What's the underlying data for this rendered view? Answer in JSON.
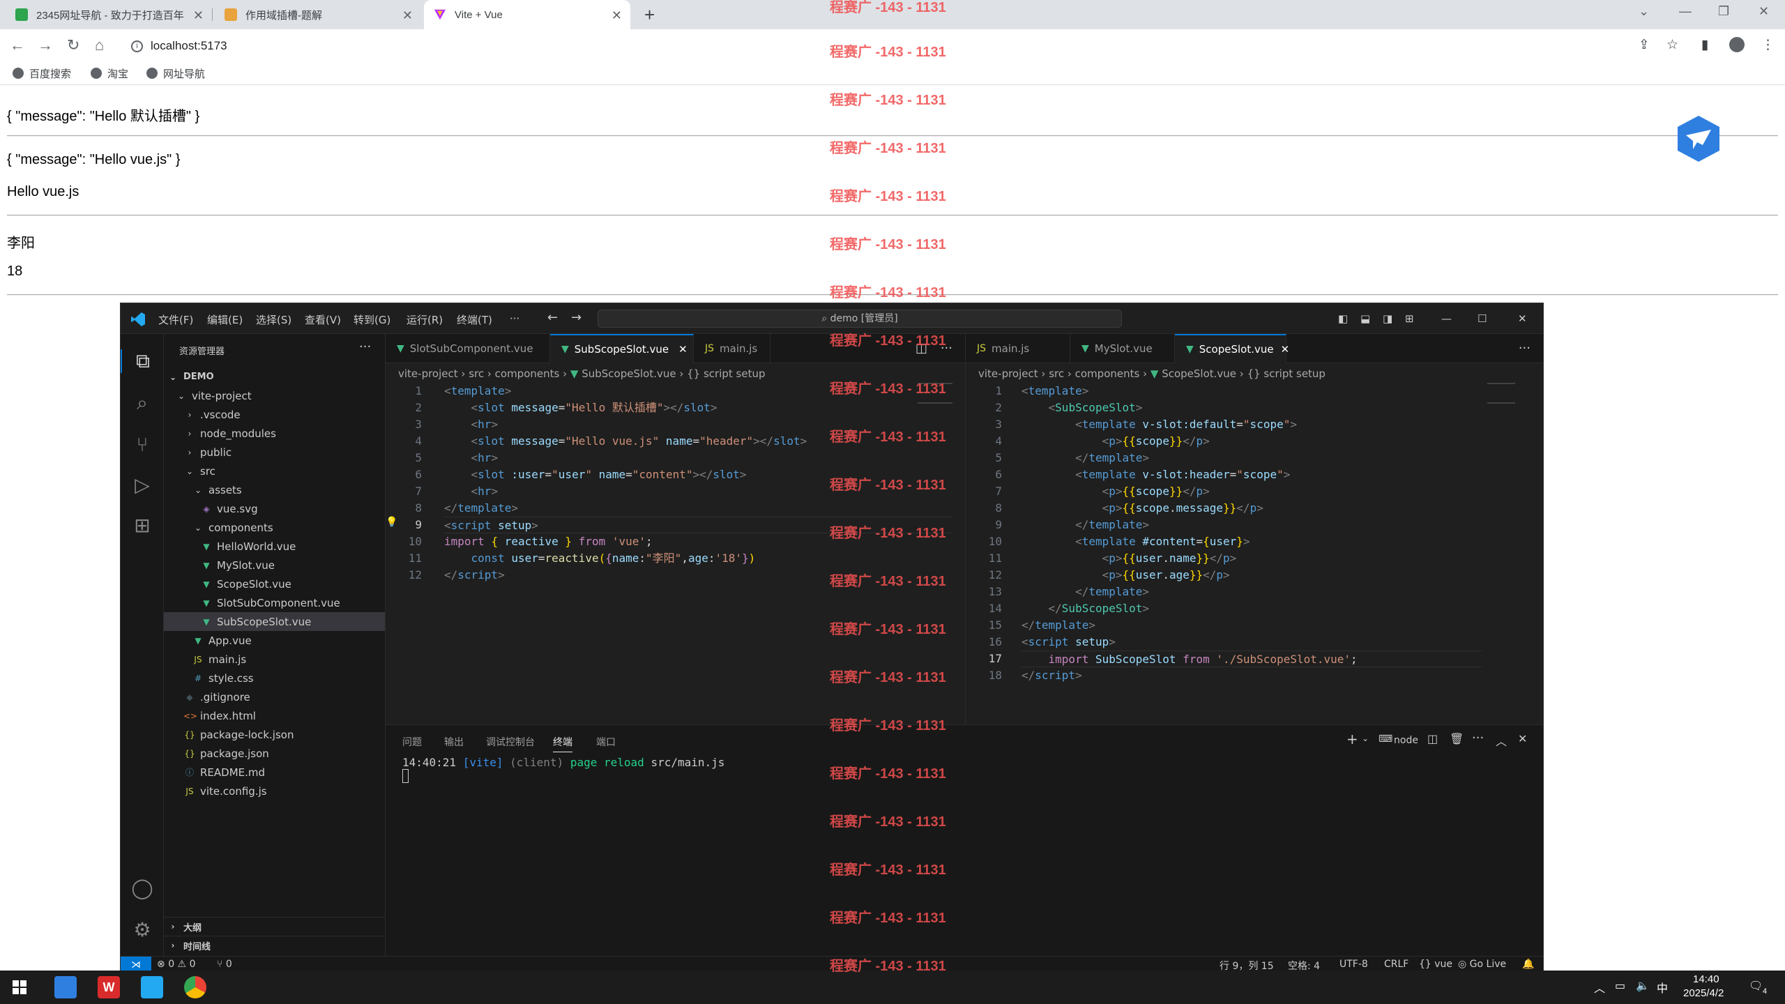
{
  "browser": {
    "tabs": [
      {
        "title": "2345网址导航 - 致力于打造百年"
      },
      {
        "title": "作用域插槽-题解"
      },
      {
        "title": "Vite + Vue"
      }
    ],
    "url": "localhost:5173",
    "bookmarks": [
      "百度搜索",
      "淘宝",
      "网址导航"
    ]
  },
  "page": {
    "lines": [
      "{ \"message\": \"Hello 默认插槽\" }",
      "{ \"message\": \"Hello vue.js\" }",
      "Hello vue.js",
      "李阳",
      "18"
    ],
    "watermark": "程赛广 -143 - 1131"
  },
  "vscode": {
    "menu": [
      "文件(F)",
      "编辑(E)",
      "选择(S)",
      "查看(V)",
      "转到(G)",
      "运行(R)",
      "终端(T)",
      "···"
    ],
    "command_center": "demo [管理员]",
    "explorer_title": "资源管理器",
    "tree": [
      {
        "label": "DEMO"
      },
      {
        "label": "vite-project"
      },
      {
        "label": ".vscode"
      },
      {
        "label": "node_modules"
      },
      {
        "label": "public"
      },
      {
        "label": "src"
      },
      {
        "label": "assets"
      },
      {
        "label": "vue.svg"
      },
      {
        "label": "components"
      },
      {
        "label": "HelloWorld.vue"
      },
      {
        "label": "MySlot.vue"
      },
      {
        "label": "ScopeSlot.vue"
      },
      {
        "label": "SlotSubComponent.vue"
      },
      {
        "label": "SubScopeSlot.vue"
      },
      {
        "label": "App.vue"
      },
      {
        "label": "main.js"
      },
      {
        "label": "style.css"
      },
      {
        "label": ".gitignore"
      },
      {
        "label": "index.html"
      },
      {
        "label": "package-lock.json"
      },
      {
        "label": "package.json"
      },
      {
        "label": "README.md"
      },
      {
        "label": "vite.config.js"
      }
    ],
    "outline": "大纲",
    "timeline": "时间线",
    "left_tabs": [
      "SlotSubComponent.vue",
      "SubScopeSlot.vue",
      "main.js"
    ],
    "left_breadcrumb": [
      "vite-project",
      "src",
      "components",
      "SubScopeSlot.vue",
      "{} script setup"
    ],
    "right_tabs": [
      "main.js",
      "MySlot.vue",
      "ScopeSlot.vue"
    ],
    "right_breadcrumb": [
      "vite-project",
      "src",
      "components",
      "ScopeSlot.vue",
      "{} script setup"
    ],
    "panel_tabs": [
      "问题",
      "输出",
      "调试控制台",
      "终端",
      "端口"
    ],
    "terminal_shell": "node",
    "terminal_time": "14:40:21",
    "terminal_tag": "[vite]",
    "terminal_client": "(client)",
    "terminal_msg": "page reload",
    "terminal_file": "src/main.js",
    "status": {
      "errors": "0",
      "warnings": "0",
      "ports": "0",
      "position": "行 9，列 15",
      "spaces": "空格: 4",
      "encoding": "UTF-8",
      "eol": "CRLF",
      "lang": "vue",
      "golive": "Go Live"
    }
  },
  "taskbar": {
    "ime": "中",
    "time": "14:40",
    "date": "2025/4/2",
    "notifications": "4"
  }
}
